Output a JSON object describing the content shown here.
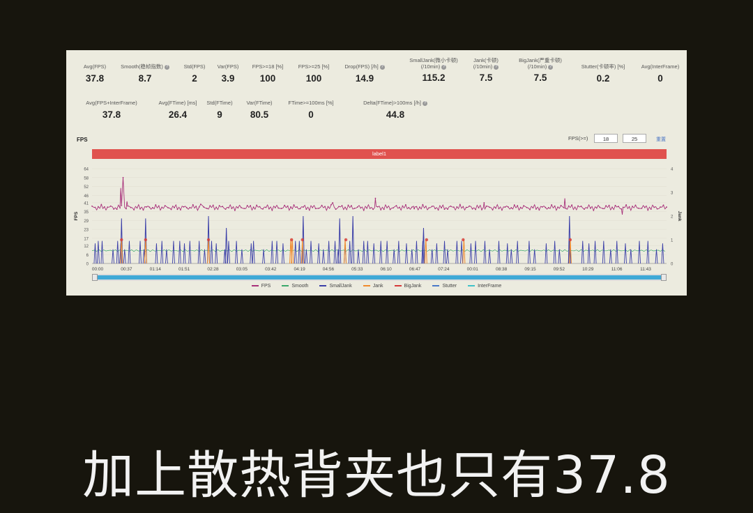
{
  "stats_row1": [
    {
      "label": "Avg(FPS)",
      "value": "37.8",
      "help": false
    },
    {
      "label": "Smooth(稳帧指数)",
      "value": "8.7",
      "help": true
    },
    {
      "label": "Std(FPS)",
      "value": "2",
      "help": false
    },
    {
      "label": "Var(FPS)",
      "value": "3.9",
      "help": false
    },
    {
      "label": "FPS>=18 [%]",
      "value": "100",
      "help": false
    },
    {
      "label": "FPS>=25 [%]",
      "value": "100",
      "help": false
    },
    {
      "label": "Drop(FPS) [/h]",
      "value": "14.9",
      "help": true
    },
    {
      "label": "SmallJank(微小卡顿)\n(/10min)",
      "value": "115.2",
      "help": true
    },
    {
      "label": "Jank(卡顿)\n(/10min)",
      "value": "7.5",
      "help": true
    },
    {
      "label": "BigJank(严重卡顿)\n(/10min)",
      "value": "7.5",
      "help": true
    },
    {
      "label": "Stutter(卡顿率) [%]",
      "value": "0.2",
      "help": false
    },
    {
      "label": "Avg(InterFrame)",
      "value": "0",
      "help": false
    }
  ],
  "stats_row2": [
    {
      "label": "Avg(FPS+InterFrame)",
      "value": "37.8",
      "help": false
    },
    {
      "label": "Avg(FTime) [ms]",
      "value": "26.4",
      "help": false
    },
    {
      "label": "Std(FTime)",
      "value": "9",
      "help": false
    },
    {
      "label": "Var(FTime)",
      "value": "80.5",
      "help": false
    },
    {
      "label": "FTime>=100ms [%]",
      "value": "0",
      "help": false
    },
    {
      "label": "Delta(FTime)>100ms [/h]",
      "value": "44.8",
      "help": true
    }
  ],
  "fps_panel": {
    "title": "FPS",
    "threshold_label": "FPS(>=)",
    "threshold_1": "18",
    "threshold_2": "25",
    "apply_label": "重置",
    "label_bar": "label1"
  },
  "legend": [
    {
      "name": "FPS",
      "color": "#a8307a"
    },
    {
      "name": "Smooth",
      "color": "#3aa86b"
    },
    {
      "name": "SmallJank",
      "color": "#3b3fa8"
    },
    {
      "name": "Jank",
      "color": "#f08a2c"
    },
    {
      "name": "BigJank",
      "color": "#d63a3a"
    },
    {
      "name": "Stutter",
      "color": "#4a78c8"
    },
    {
      "name": "InterFrame",
      "color": "#3fc1c9"
    }
  ],
  "caption": "加上散热背夹也只有37.8",
  "chart_data": {
    "type": "line",
    "ylabel": "FPS",
    "y2label": "Jank",
    "ylim": [
      0,
      64
    ],
    "y2lim": [
      0,
      4
    ],
    "y_ticks": [
      "0",
      "6",
      "12",
      "17",
      "23",
      "29",
      "35",
      "41",
      "46",
      "52",
      "58",
      "64"
    ],
    "y2_ticks": [
      "0",
      "1",
      "2",
      "3",
      "4"
    ],
    "x_ticks": [
      "00:00",
      "00:37",
      "01:14",
      "01:51",
      "02:28",
      "03:05",
      "03:42",
      "04:19",
      "04:56",
      "05:33",
      "06:10",
      "06:47",
      "07:24",
      "00:01",
      "08:38",
      "09:15",
      "09:52",
      "10:29",
      "11:06",
      "11:43"
    ],
    "x_max_seconds": 740,
    "fps_baseline": 37.8,
    "fps_spikes": [
      {
        "t": 40,
        "v": 58
      },
      {
        "t": 37,
        "v": 51
      },
      {
        "t": 45,
        "v": 42
      },
      {
        "t": 140,
        "v": 40
      },
      {
        "t": 310,
        "v": 41
      },
      {
        "t": 365,
        "v": 44
      },
      {
        "t": 415,
        "v": 37
      },
      {
        "t": 505,
        "v": 41
      },
      {
        "t": 609,
        "v": 44
      },
      {
        "t": 683,
        "v": 33
      }
    ],
    "smooth_level": 8.7,
    "smalljank_times": [
      4,
      8,
      13,
      27,
      33,
      37,
      42,
      48,
      62,
      67,
      83,
      90,
      96,
      105,
      113,
      119,
      126,
      138,
      145,
      154,
      160,
      171,
      176,
      186,
      193,
      205,
      208,
      221,
      232,
      238,
      246,
      262,
      267,
      276,
      282,
      292,
      298,
      305,
      313,
      317,
      326,
      332,
      343,
      350,
      355,
      363,
      372,
      380,
      389,
      395,
      405,
      412,
      418,
      426,
      438,
      444,
      454,
      458,
      470,
      476,
      488,
      494,
      506,
      512,
      524,
      535,
      540,
      548,
      563,
      570,
      585,
      596,
      602,
      615,
      632,
      640,
      648,
      659,
      668,
      676,
      687,
      694,
      705,
      716,
      727,
      735
    ],
    "smalljank_big": [
      {
        "t": 38,
        "v": 1.9
      },
      {
        "t": 69,
        "v": 1.9
      },
      {
        "t": 150,
        "v": 2.0
      },
      {
        "t": 173,
        "v": 1.5
      },
      {
        "t": 272,
        "v": 2.0
      },
      {
        "t": 319,
        "v": 1.9
      },
      {
        "t": 336,
        "v": 2.0
      },
      {
        "t": 427,
        "v": 1.5
      },
      {
        "t": 615,
        "v": 2.0
      }
    ],
    "jank_times": [
      38,
      69,
      150,
      256,
      258,
      271,
      326,
      430,
      479,
      616
    ],
    "bigjank_times": [
      38,
      69,
      150,
      257,
      271,
      327,
      431,
      478,
      616
    ]
  }
}
